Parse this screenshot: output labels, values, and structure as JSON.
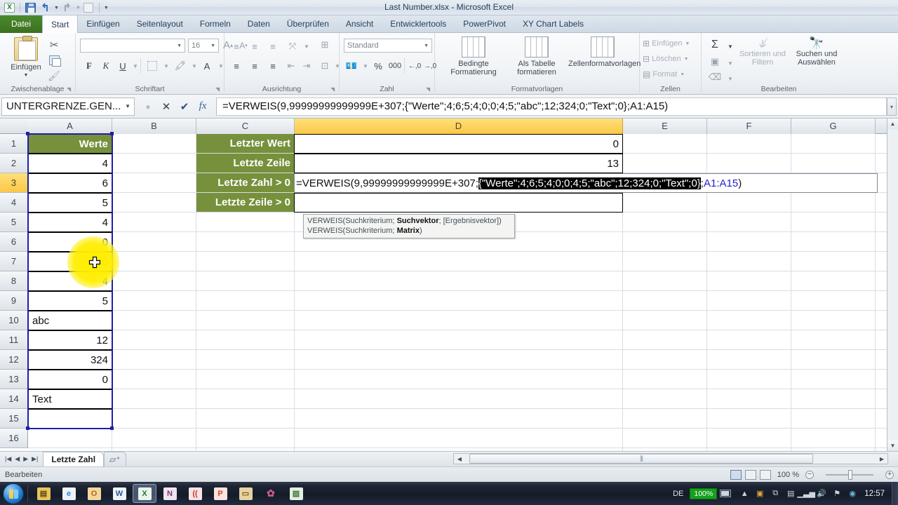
{
  "window": {
    "title": "Last Number.xlsx  -  Microsoft Excel",
    "qat": {
      "excel_logo": "excel-logo",
      "save": "Speichern",
      "undo": "Rückgängig",
      "redo": "Wiederholen",
      "print_preview": "Seitenansicht",
      "customize": "Symbolleiste für den Schnellzugriff anpassen"
    }
  },
  "ribbon": {
    "tabs": [
      {
        "label": "Datei",
        "state": "file"
      },
      {
        "label": "Start",
        "state": "active"
      },
      {
        "label": "Einfügen",
        "state": "normal"
      },
      {
        "label": "Seitenlayout",
        "state": "normal"
      },
      {
        "label": "Formeln",
        "state": "normal"
      },
      {
        "label": "Daten",
        "state": "normal"
      },
      {
        "label": "Überprüfen",
        "state": "normal"
      },
      {
        "label": "Ansicht",
        "state": "normal"
      },
      {
        "label": "Entwicklertools",
        "state": "normal"
      },
      {
        "label": "PowerPivot",
        "state": "normal"
      },
      {
        "label": "XY Chart Labels",
        "state": "normal"
      }
    ],
    "groups": {
      "clipboard": {
        "name": "Zwischenablage",
        "paste": "Einfügen",
        "cut": "Ausschneiden",
        "copy": "Kopieren",
        "format_painter": "Format übertragen"
      },
      "font": {
        "name": "Schriftart",
        "font_name": "",
        "font_size": "16",
        "grow": "A",
        "shrink": "A",
        "bold": "F",
        "italic": "K",
        "underline": "U",
        "borders": "borders-icon",
        "fill": "fill-color-icon",
        "color": "A"
      },
      "alignment": {
        "name": "Ausrichtung",
        "top": "oben ausrichten",
        "middle": "vertikal zentrieren",
        "bottom": "unten ausrichten",
        "orientation": "Ausrichtung",
        "align_left": "linksbündig",
        "align_center": "zentriert",
        "align_right": "rechtsbündig",
        "indent_dec": "Einzug verkleinern",
        "indent_inc": "Einzug vergrößern",
        "wrap": "Zeilenumbruch",
        "merge": "Verbinden und zentrieren"
      },
      "number": {
        "name": "Zahl",
        "format": "Standard",
        "currency": "Buchhaltungsformat",
        "percent": "%",
        "thousands": "000",
        "dec_inc": "Dezimalstelle hinzufügen",
        "dec_dec": "Dezimalstelle löschen"
      },
      "styles": {
        "name": "Formatvorlagen",
        "conditional": "Bedingte Formatierung",
        "as_table": "Als Tabelle formatieren",
        "cell_styles": "Zellenformatvorlagen"
      },
      "cells": {
        "name": "Zellen",
        "insert": "Einfügen",
        "delete": "Löschen",
        "format": "Format"
      },
      "editing": {
        "name": "Bearbeiten",
        "autosum": "Σ",
        "fill": "Füllbereich",
        "clear": "Löschen",
        "sort_filter": "Sortieren und Filtern",
        "find_select": "Suchen und Auswählen"
      }
    }
  },
  "formula_bar": {
    "name_box": "UNTERGRENZE.GEN...",
    "cancel_icon": "x-icon",
    "confirm_icon": "check-icon",
    "fx_icon": "fx-icon",
    "formula": "=VERWEIS(9,99999999999999E+307;{\"Werte\";4;6;5;4;0;0;4;5;\"abc\";12;324;0;\"Text\";0};A1:A15)"
  },
  "grid": {
    "column_headers": [
      "A",
      "B",
      "C",
      "D",
      "E",
      "F",
      "G"
    ],
    "selected_column": "D",
    "row_headers": [
      "1",
      "2",
      "3",
      "4",
      "5",
      "6",
      "7",
      "8",
      "9",
      "10",
      "11",
      "12",
      "13",
      "14",
      "15",
      "16"
    ],
    "selected_row": "3",
    "column_a": [
      {
        "row": "1",
        "value": "Werte",
        "style": "header-green"
      },
      {
        "row": "2",
        "value": "4",
        "style": "number"
      },
      {
        "row": "3",
        "value": "6",
        "style": "number"
      },
      {
        "row": "4",
        "value": "5",
        "style": "number"
      },
      {
        "row": "5",
        "value": "4",
        "style": "number"
      },
      {
        "row": "6",
        "value": "0",
        "style": "number"
      },
      {
        "row": "7",
        "value": "0",
        "style": "number-hidden-by-cursor"
      },
      {
        "row": "8",
        "value": "4",
        "style": "number"
      },
      {
        "row": "9",
        "value": "5",
        "style": "number"
      },
      {
        "row": "10",
        "value": "abc",
        "style": "text"
      },
      {
        "row": "11",
        "value": "12",
        "style": "number"
      },
      {
        "row": "12",
        "value": "324",
        "style": "number"
      },
      {
        "row": "13",
        "value": "0",
        "style": "number"
      },
      {
        "row": "14",
        "value": "Text",
        "style": "text"
      },
      {
        "row": "15",
        "value": "",
        "style": "empty"
      },
      {
        "row": "16",
        "value": "",
        "style": "empty"
      }
    ],
    "column_c_labels": [
      {
        "row": "1",
        "value": "Letzter Wert"
      },
      {
        "row": "2",
        "value": "Letzte Zeile"
      },
      {
        "row": "3",
        "value": "Letzte  Zahl > 0"
      },
      {
        "row": "4",
        "value": "Letzte  Zeile > 0"
      }
    ],
    "column_d_values": [
      {
        "row": "1",
        "value": "0"
      },
      {
        "row": "2",
        "value": "13"
      }
    ],
    "editing_cell": {
      "address": "D3",
      "prefix": "=VERWEIS(9,99999999999999E+307;",
      "selected_part": "{\"Werte\";4;6;5;4;0;0;4;5;\"abc\";12;324;0;\"Text\";0}",
      "mid": ";",
      "reference": "A1:A15",
      "suffix": ")"
    },
    "function_tooltip": {
      "line1_pre": "VERWEIS(Suchkriterium; ",
      "line1_bold": "Suchvektor",
      "line1_post": "; [Ergebnisvektor])",
      "line2_pre": "VERWEIS(Suchkriterium; ",
      "line2_bold": "Matrix",
      "line2_post": ")"
    },
    "selection_range": "A1:A15"
  },
  "sheet_bar": {
    "nav_first": "|◀",
    "nav_prev": "◀",
    "nav_next": "▶",
    "nav_last": "▶|",
    "tabs": [
      "Letzte Zahl"
    ],
    "add_sheet": "Tabellenblatt einfügen"
  },
  "status_bar": {
    "mode": "Bearbeiten",
    "view_normal": "Normal",
    "view_layout": "Seitenlayout",
    "view_break": "Umbruchvorschau",
    "zoom": "100 %",
    "zoom_out": "−",
    "zoom_in": "+"
  },
  "taskbar": {
    "start": "Start",
    "items": [
      {
        "name": "explorer-icon",
        "glyph": "🗂",
        "color": "#e8c55a"
      },
      {
        "name": "internet-explorer-icon",
        "glyph": "e",
        "color": "#2f87d0"
      },
      {
        "name": "outlook-icon",
        "glyph": "O",
        "color": "#e8a33d"
      },
      {
        "name": "word-icon",
        "glyph": "W",
        "color": "#2b579a"
      },
      {
        "name": "excel-icon",
        "glyph": "X",
        "color": "#1f7a3d"
      },
      {
        "name": "onenote-icon",
        "glyph": "N",
        "color": "#80397b"
      },
      {
        "name": "media-icon",
        "glyph": "((",
        "color": "#cc3333"
      },
      {
        "name": "powerpoint-icon",
        "glyph": "P",
        "color": "#d24726"
      },
      {
        "name": "folder-icon",
        "glyph": "▭",
        "color": "#d9a43c"
      },
      {
        "name": "paint-icon",
        "glyph": "✿",
        "color": "#c75b8c"
      },
      {
        "name": "snagit-icon",
        "glyph": "▨",
        "color": "#3e7a3e"
      }
    ],
    "tray": {
      "language": "DE",
      "battery": "100%",
      "clock": "12:57"
    }
  }
}
